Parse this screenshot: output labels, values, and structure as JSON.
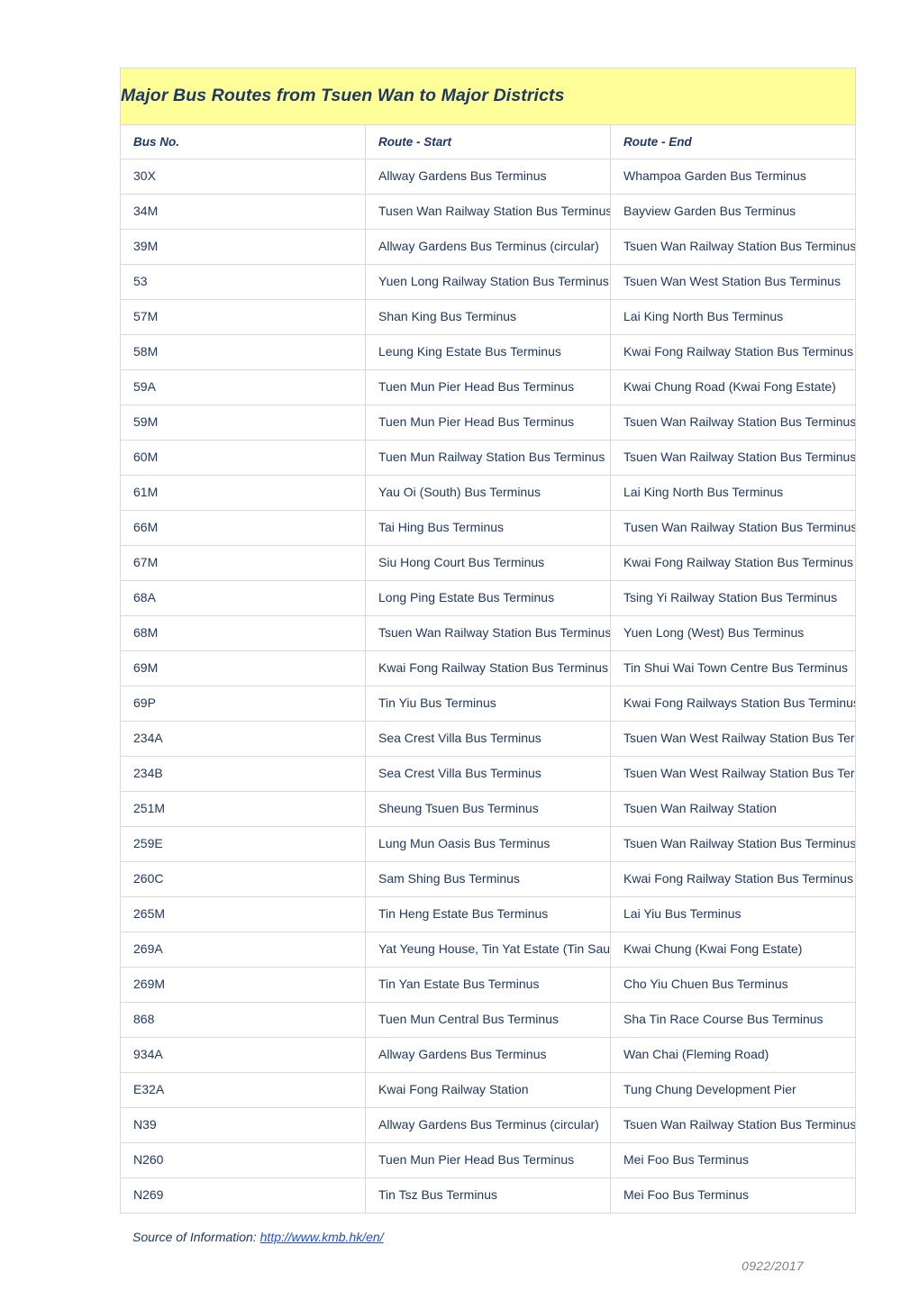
{
  "document": {
    "title": "Major Bus Routes from Tsuen Wan to Major Districts",
    "title_bg": "#FFFF99",
    "text_color": "#1F3864",
    "link_color": "#1D4ED8",
    "date_color": "#808080"
  },
  "table": {
    "columns": [
      {
        "key": "bus_no",
        "label": "Bus No."
      },
      {
        "key": "route_start",
        "label": "Route - Start"
      },
      {
        "key": "route_end",
        "label": "Route - End"
      }
    ],
    "rows": [
      {
        "bus_no": "30X",
        "route_start": "Allway Gardens Bus Terminus",
        "route_end": "Whampoa Garden Bus Terminus"
      },
      {
        "bus_no": "34M",
        "route_start": "Tusen Wan Railway Station Bus Terminus (circular)",
        "route_end": "Bayview Garden Bus Terminus"
      },
      {
        "bus_no": "39M",
        "route_start": "Allway Gardens Bus Terminus (circular)",
        "route_end": "Tsuen Wan Railway Station Bus Terminus"
      },
      {
        "bus_no": "53",
        "route_start": "Yuen Long Railway Station Bus Terminus",
        "route_end": "Tsuen Wan West Station Bus Terminus"
      },
      {
        "bus_no": "57M",
        "route_start": "Shan King Bus Terminus",
        "route_end": "Lai King North Bus Terminus"
      },
      {
        "bus_no": "58M",
        "route_start": "Leung King Estate Bus Terminus",
        "route_end": "Kwai Fong Railway Station Bus Terminus"
      },
      {
        "bus_no": "59A",
        "route_start": "Tuen Mun Pier Head Bus Terminus",
        "route_end": "Kwai Chung Road (Kwai Fong Estate)"
      },
      {
        "bus_no": "59M",
        "route_start": "Tuen Mun Pier Head Bus Terminus",
        "route_end": "Tsuen Wan Railway Station Bus Terminus"
      },
      {
        "bus_no": "60M",
        "route_start": "Tuen Mun Railway Station Bus Terminus",
        "route_end": "Tsuen Wan Railway Station Bus Terminus"
      },
      {
        "bus_no": "61M",
        "route_start": "Yau Oi (South) Bus Terminus",
        "route_end": "Lai King North Bus Terminus"
      },
      {
        "bus_no": "66M",
        "route_start": "Tai Hing Bus Terminus",
        "route_end": "Tusen Wan Railway Station Bus Terminus"
      },
      {
        "bus_no": "67M",
        "route_start": "Siu Hong Court Bus Terminus",
        "route_end": "Kwai Fong Railway Station Bus Terminus"
      },
      {
        "bus_no": "68A",
        "route_start": "Long Ping Estate Bus Terminus",
        "route_end": "Tsing Yi Railway Station Bus Terminus"
      },
      {
        "bus_no": "68M",
        "route_start": "Tsuen Wan Railway Station Bus Terminus",
        "route_end": "Yuen Long (West) Bus Terminus"
      },
      {
        "bus_no": "69M",
        "route_start": "Kwai Fong Railway Station Bus Terminus",
        "route_end": "Tin Shui Wai Town Centre Bus Terminus"
      },
      {
        "bus_no": "69P",
        "route_start": "Tin Yiu Bus Terminus",
        "route_end": "Kwai Fong Railways Station Bus Terminus"
      },
      {
        "bus_no": "234A",
        "route_start": "Sea Crest Villa Bus Terminus",
        "route_end": "Tsuen Wan West Railway Station Bus Terminus"
      },
      {
        "bus_no": "234B",
        "route_start": "Sea Crest Villa Bus Terminus",
        "route_end": "Tsuen Wan West Railway Station Bus Terminus"
      },
      {
        "bus_no": "251M",
        "route_start": "Sheung Tsuen Bus Terminus",
        "route_end": "Tsuen Wan Railway Station"
      },
      {
        "bus_no": "259E",
        "route_start": "Lung Mun Oasis Bus Terminus",
        "route_end": "Tsuen Wan Railway Station Bus Terminus"
      },
      {
        "bus_no": "260C",
        "route_start": "Sam Shing Bus Terminus",
        "route_end": "Kwai Fong Railway Station Bus Terminus"
      },
      {
        "bus_no": "265M",
        "route_start": "Tin Heng Estate Bus Terminus",
        "route_end": "Lai Yiu Bus Terminus"
      },
      {
        "bus_no": "269A",
        "route_start": "Yat Yeung House, Tin Yat Estate (Tin Sau Road)",
        "route_end": "Kwai Chung (Kwai Fong Estate)"
      },
      {
        "bus_no": "269M",
        "route_start": "Tin Yan Estate Bus Terminus",
        "route_end": "Cho Yiu Chuen Bus Terminus"
      },
      {
        "bus_no": "868",
        "route_start": "Tuen Mun Central Bus Terminus",
        "route_end": "Sha Tin Race Course Bus Terminus"
      },
      {
        "bus_no": "934A",
        "route_start": "Allway Gardens Bus Terminus",
        "route_end": "Wan Chai (Fleming Road)"
      },
      {
        "bus_no": "E32A",
        "route_start": "Kwai Fong Railway Station",
        "route_end": "Tung Chung Development Pier"
      },
      {
        "bus_no": "N39",
        "route_start": "Allway Gardens Bus Terminus (circular)",
        "route_end": "Tsuen Wan Railway Station Bus Terminus"
      },
      {
        "bus_no": "N260",
        "route_start": "Tuen Mun Pier Head Bus Terminus",
        "route_end": "Mei Foo Bus Terminus"
      },
      {
        "bus_no": "N269",
        "route_start": "Tin Tsz Bus Terminus",
        "route_end": "Mei Foo Bus Terminus"
      }
    ]
  },
  "footer": {
    "source_label": "Source of Information:",
    "source_url_text": "http://www.kmb.hk/en/",
    "date": "0922/2017"
  }
}
